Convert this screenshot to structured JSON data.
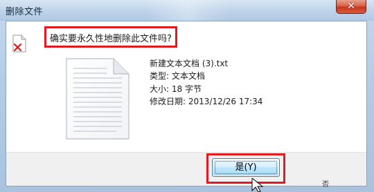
{
  "window": {
    "title": "删除文件",
    "close_glyph": "✕"
  },
  "dialog": {
    "question": "确实要永久性地删除此文件吗?",
    "file": {
      "name": "新建文本文档 (3).txt",
      "type_line": "类型: 文本文档",
      "size_line": "大小: 18 字节",
      "modified_line": "修改日期: 2013/12/26 17:34"
    },
    "buttons": {
      "yes_label": "是(Y)",
      "partial_label": "否"
    }
  },
  "icons": {
    "warning": "delete-file-icon",
    "document": "text-document-icon"
  },
  "colors": {
    "highlight": "#e0191e",
    "close_button": "#c7381f",
    "yes_button": "#bee6fd"
  }
}
